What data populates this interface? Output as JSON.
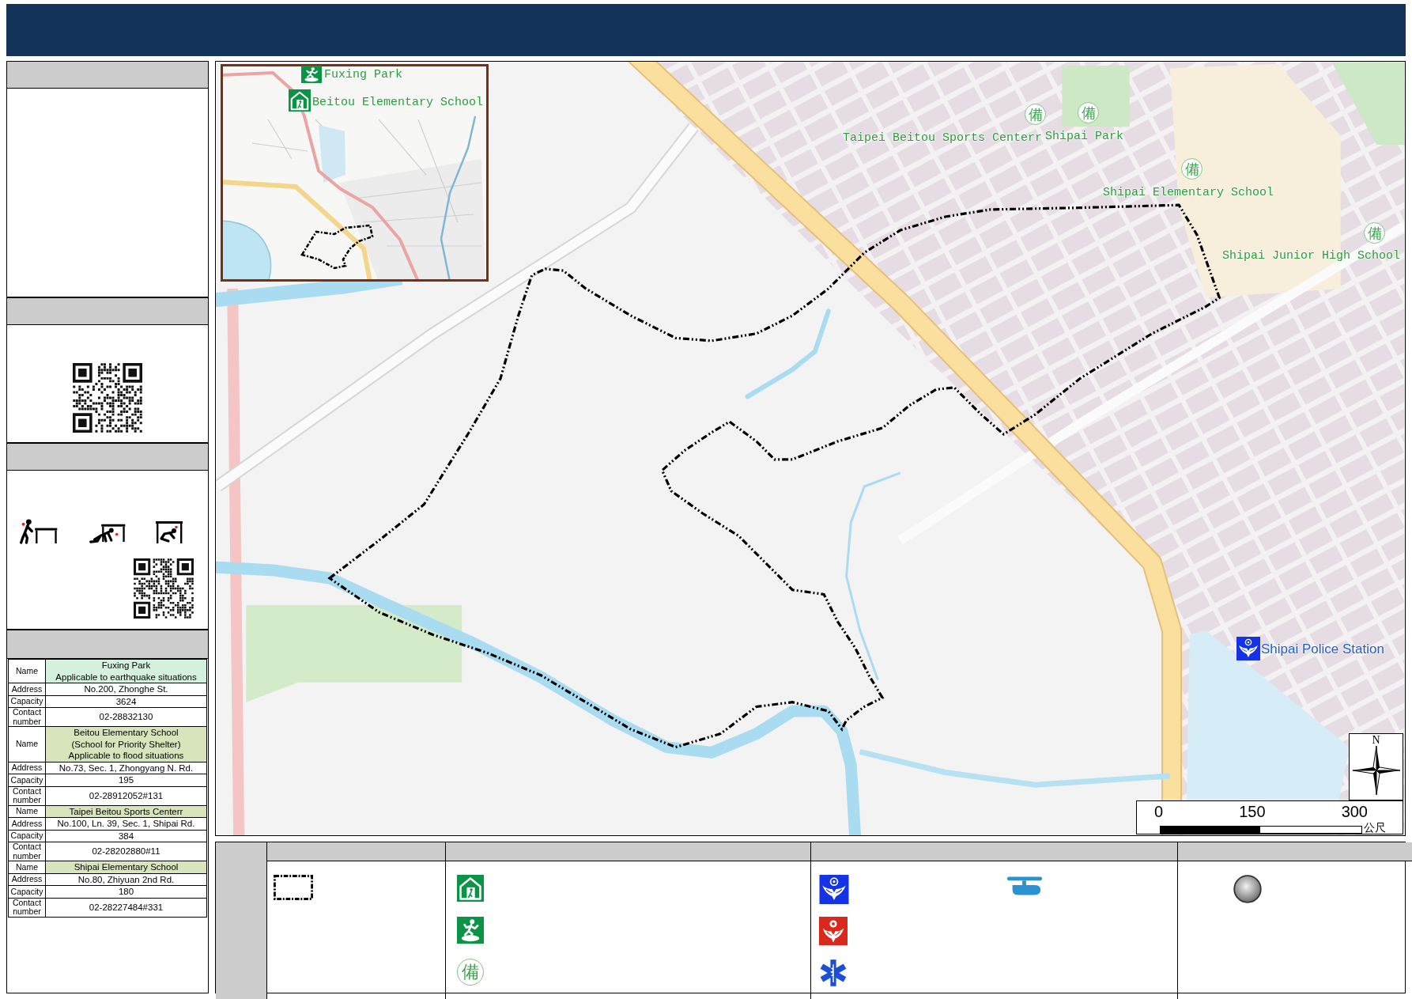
{
  "shelter_table": [
    {
      "color": "#d3f1dd",
      "rows": [
        {
          "label": "Name",
          "value": "Fuxing Park\nApplicable to earthquake situations"
        },
        {
          "label": "Address",
          "value": "No.200, Zhonghe St."
        },
        {
          "label": "Capacity",
          "value": "3624"
        },
        {
          "label": "Contact number",
          "value": "02-28832130"
        }
      ]
    },
    {
      "color": "#d8e4bc",
      "rows": [
        {
          "label": "Name",
          "value": "Beitou Elementary School\n(School for Priority Shelter)\nApplicable to flood situations"
        },
        {
          "label": "Address",
          "value": "No.73, Sec. 1, Zhongyang N. Rd."
        },
        {
          "label": "Capacity",
          "value": "195"
        },
        {
          "label": "Contact number",
          "value": "02-28912052#131"
        }
      ]
    },
    {
      "color": "#d8e4bc",
      "rows": [
        {
          "label": "Name",
          "value": "Taipei Beitou Sports Centerr"
        },
        {
          "label": "Address",
          "value": "No.100, Ln. 39, Sec. 1, Shipai Rd."
        },
        {
          "label": "Capacity",
          "value": "384"
        },
        {
          "label": "Contact number",
          "value": "02-28202880#11"
        }
      ]
    },
    {
      "color": "#d8e4bc",
      "rows": [
        {
          "label": "Name",
          "value": "Shipai Elementary School"
        },
        {
          "label": "Address",
          "value": "No.80, Zhiyuan 2nd Rd."
        },
        {
          "label": "Capacity",
          "value": "180"
        },
        {
          "label": "Contact number",
          "value": "02-28227484#331"
        }
      ]
    }
  ],
  "map": {
    "markers": [
      {
        "kind": "evacuation_site",
        "label": "Fuxing Park"
      },
      {
        "kind": "shelter",
        "label": "Beitou Elementary School"
      },
      {
        "kind": "standby_shelter",
        "glyph": "備",
        "label": "Taipei Beitou Sports Centerr"
      },
      {
        "kind": "standby_shelter",
        "glyph": "備",
        "label": "Shipai Park"
      },
      {
        "kind": "standby_shelter",
        "glyph": "備",
        "label": "Shipai Elementary School"
      },
      {
        "kind": "standby_shelter",
        "glyph": "備",
        "label": "Shipai Junior High School"
      },
      {
        "kind": "police",
        "label": "Shipai Police Station"
      }
    ],
    "compass": {
      "label": "N"
    },
    "scale": {
      "ticks": [
        "0",
        "150",
        "300"
      ],
      "unit": "公尺"
    }
  },
  "legend": {
    "groups": [
      {
        "items": [
          {
            "kind": "boundary"
          }
        ]
      },
      {
        "items": [
          {
            "kind": "shelter"
          },
          {
            "kind": "evacuation_site"
          },
          {
            "kind": "standby_shelter",
            "glyph": "備"
          }
        ]
      },
      {
        "items": [
          {
            "kind": "police"
          },
          {
            "kind": "fire"
          },
          {
            "kind": "ambulance"
          },
          {
            "kind": "helicopter"
          }
        ]
      },
      {
        "items": [
          {
            "kind": "circle_marker"
          }
        ]
      }
    ]
  }
}
